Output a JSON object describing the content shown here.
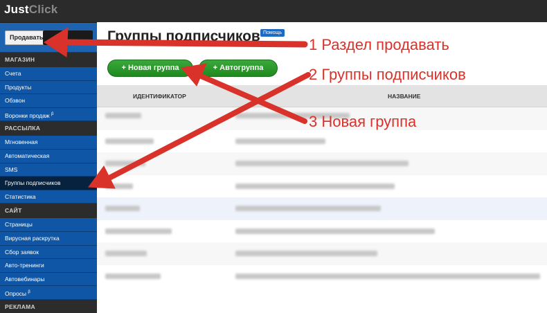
{
  "app": {
    "logo_part1": "Just",
    "logo_part2": "Click"
  },
  "sidebar": {
    "sell_button": "Продавать",
    "sections": [
      {
        "title": "МАГАЗИН",
        "items": [
          {
            "label": "Счета"
          },
          {
            "label": "Продукты"
          },
          {
            "label": "Обзвон"
          },
          {
            "label": "Воронки продаж",
            "sup": "β"
          }
        ]
      },
      {
        "title": "РАССЫЛКА",
        "items": [
          {
            "label": "Мгновенная"
          },
          {
            "label": "Автоматическая"
          },
          {
            "label": "SMS"
          },
          {
            "label": "Группы подписчиков",
            "active": true
          },
          {
            "label": "Статистика"
          }
        ]
      },
      {
        "title": "САЙТ",
        "items": [
          {
            "label": "Страницы"
          },
          {
            "label": "Вирусная раскрутка"
          },
          {
            "label": "Сбор заявок"
          },
          {
            "label": "Авто-тренинги"
          },
          {
            "label": "Автовебинары"
          },
          {
            "label": "Опросы",
            "sup": "β"
          }
        ]
      },
      {
        "title": "РЕКЛАМА",
        "items": []
      }
    ]
  },
  "main": {
    "page_title": "Группы подписчиков",
    "help_badge": "Помощь",
    "new_group_button": "+ Новая группа",
    "auto_group_button": "+ Автогруппа",
    "table": {
      "columns": [
        "ИДЕНТИФИКАТОР",
        "НАЗВАНИЕ"
      ]
    }
  },
  "annotations": [
    "1 Раздел продавать",
    "2 Группы подписчиков",
    "3 Новая группа"
  ],
  "colors": {
    "arrow": "#d8322a",
    "sidebar": "#0f57a6",
    "button_green": "#2b9a2b"
  }
}
